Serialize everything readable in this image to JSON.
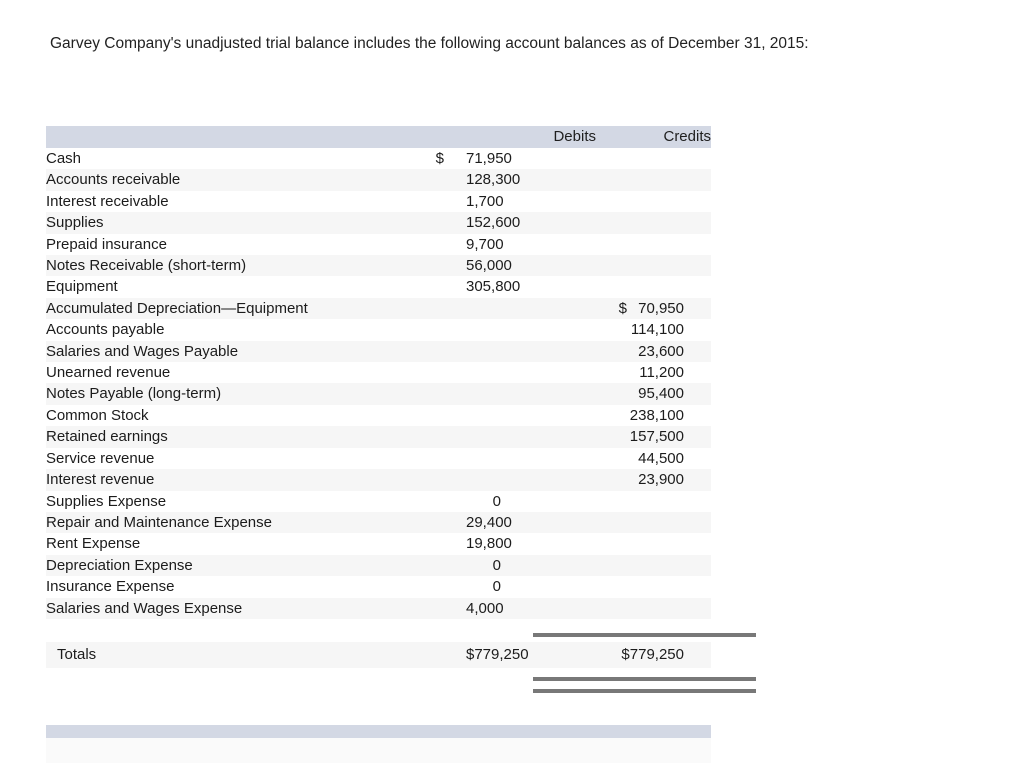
{
  "prompt": {
    "text": "Garvey Company's unadjusted trial balance includes the following account balances as of December 31, 2015:"
  },
  "table": {
    "columns": {
      "account": "",
      "debits": "Debits",
      "credits": "Credits"
    },
    "rows": [
      {
        "account": "Cash",
        "debit": "71,950",
        "debit_symbol": "$",
        "credit": "",
        "credit_symbol": ""
      },
      {
        "account": "Accounts receivable",
        "debit": "128,300",
        "debit_symbol": "",
        "credit": "",
        "credit_symbol": ""
      },
      {
        "account": "Interest receivable",
        "debit": "1,700",
        "debit_symbol": "",
        "credit": "",
        "credit_symbol": ""
      },
      {
        "account": "Supplies",
        "debit": "152,600",
        "debit_symbol": "",
        "credit": "",
        "credit_symbol": ""
      },
      {
        "account": "Prepaid insurance",
        "debit": "9,700",
        "debit_symbol": "",
        "credit": "",
        "credit_symbol": ""
      },
      {
        "account": "Notes Receivable (short-term)",
        "debit": "56,000",
        "debit_symbol": "",
        "credit": "",
        "credit_symbol": ""
      },
      {
        "account": "Equipment",
        "debit": "305,800",
        "debit_symbol": "",
        "credit": "",
        "credit_symbol": ""
      },
      {
        "account": "Accumulated Depreciation—Equipment",
        "debit": "",
        "debit_symbol": "",
        "credit": "70,950",
        "credit_symbol": "$"
      },
      {
        "account": "Accounts payable",
        "debit": "",
        "debit_symbol": "",
        "credit": "114,100",
        "credit_symbol": ""
      },
      {
        "account": "Salaries and Wages Payable",
        "debit": "",
        "debit_symbol": "",
        "credit": "23,600",
        "credit_symbol": ""
      },
      {
        "account": "Unearned revenue",
        "debit": "",
        "debit_symbol": "",
        "credit": "11,200",
        "credit_symbol": ""
      },
      {
        "account": "Notes Payable (long-term)",
        "debit": "",
        "debit_symbol": "",
        "credit": "95,400",
        "credit_symbol": ""
      },
      {
        "account": "Common Stock",
        "debit": "",
        "debit_symbol": "",
        "credit": "238,100",
        "credit_symbol": ""
      },
      {
        "account": "Retained earnings",
        "debit": "",
        "debit_symbol": "",
        "credit": "157,500",
        "credit_symbol": ""
      },
      {
        "account": "Service revenue",
        "debit": "",
        "debit_symbol": "",
        "credit": "44,500",
        "credit_symbol": ""
      },
      {
        "account": "Interest revenue",
        "debit": "",
        "debit_symbol": "",
        "credit": "23,900",
        "credit_symbol": ""
      },
      {
        "account": "Supplies Expense",
        "debit": "0",
        "debit_symbol": "",
        "credit": "",
        "credit_symbol": ""
      },
      {
        "account": "Repair and Maintenance Expense",
        "debit": "29,400",
        "debit_symbol": "",
        "credit": "",
        "credit_symbol": ""
      },
      {
        "account": "Rent Expense",
        "debit": "19,800",
        "debit_symbol": "",
        "credit": "",
        "credit_symbol": ""
      },
      {
        "account": "Depreciation Expense",
        "debit": "0",
        "debit_symbol": "",
        "credit": "",
        "credit_symbol": ""
      },
      {
        "account": "Insurance Expense",
        "debit": "0",
        "debit_symbol": "",
        "credit": "",
        "credit_symbol": ""
      },
      {
        "account": "Salaries and Wages Expense",
        "debit": "4,000",
        "debit_symbol": "",
        "credit": "",
        "credit_symbol": ""
      }
    ],
    "totals": {
      "label": "Totals",
      "debit": "$779,250",
      "credit": "$779,250"
    }
  },
  "colors": {
    "header_band": "#d3d8e4",
    "row_stripe": "#f6f6f6",
    "rule": "#787878",
    "text": "#1c1c1c"
  }
}
